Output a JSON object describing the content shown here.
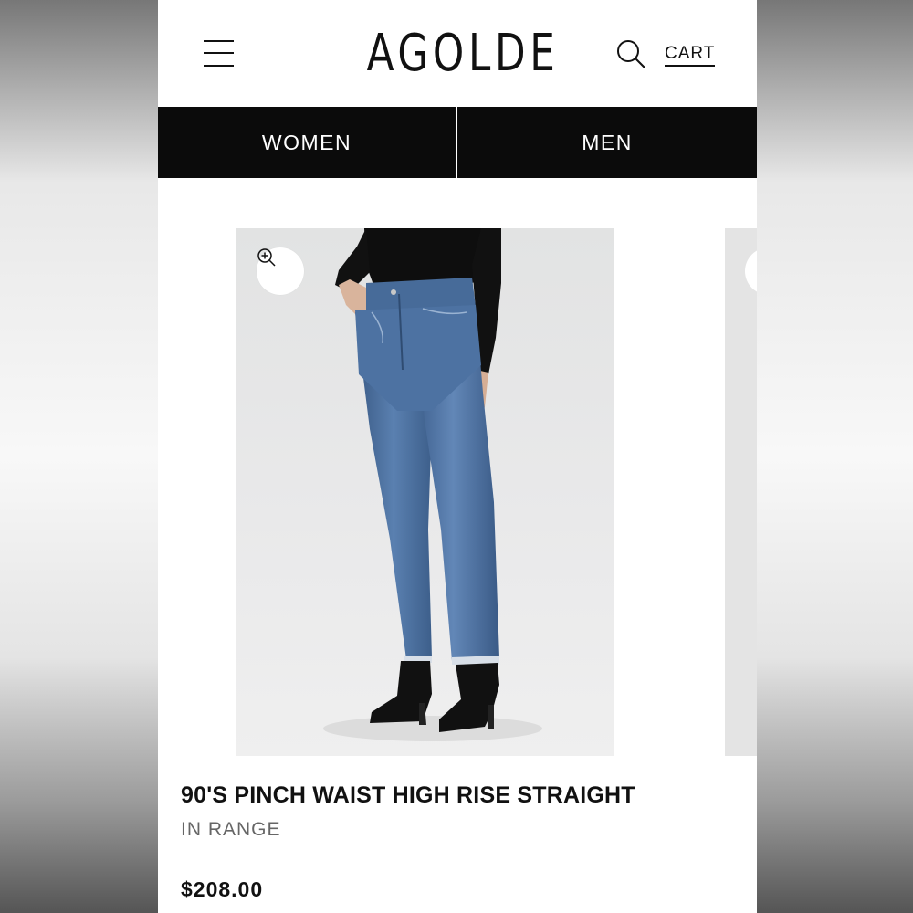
{
  "header": {
    "menu_icon": "hamburger-menu-icon",
    "logo": "AGOLDE",
    "search_icon": "search-icon",
    "cart_label": "CART"
  },
  "gender_tabs": [
    {
      "label": "WOMEN"
    },
    {
      "label": "MEN"
    }
  ],
  "product": {
    "zoom_icon": "zoom-in-icon",
    "title": "90'S PINCH WAIST HIGH RISE STRAIGHT",
    "color": "IN RANGE",
    "price": "$208.00"
  },
  "colors": {
    "tab_background": "#0b0b0b",
    "text_primary": "#111111",
    "text_secondary": "#666666",
    "denim": "#4a6e9c"
  }
}
